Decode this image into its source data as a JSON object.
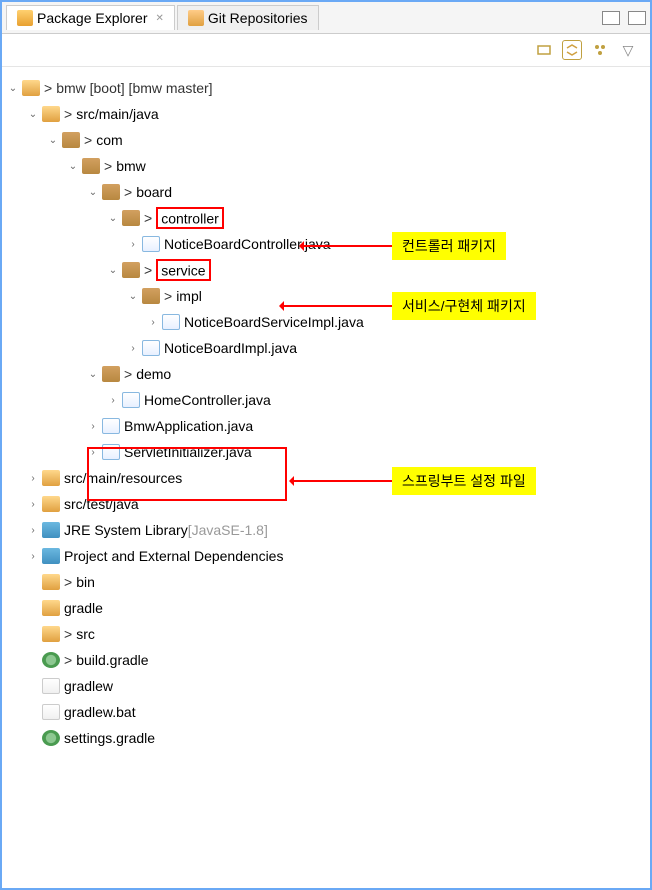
{
  "tabs": {
    "active": "Package Explorer",
    "inactive": "Git Repositories"
  },
  "tree": {
    "root": "bmw [boot] [bmw master]",
    "srcMainJava": "src/main/java",
    "com": "com",
    "bmw": "bmw",
    "board": "board",
    "controller": "controller",
    "noticeBoardController": "NoticeBoardController.java",
    "service": "service",
    "impl": "impl",
    "noticeBoardServiceImpl": "NoticeBoardServiceImpl.java",
    "noticeBoardImpl": "NoticeBoardImpl.java",
    "demo": "demo",
    "homeController": "HomeController.java",
    "bmwApplication": "BmwApplication.java",
    "servletInitializer": "ServletInitializer.java",
    "srcMainResources": "src/main/resources",
    "srcTestJava": "src/test/java",
    "jreLibrary": "JRE System Library",
    "jreSuffix": " [JavaSE-1.8]",
    "projectDeps": "Project and External Dependencies",
    "bin": "bin",
    "gradle": "gradle",
    "src": "src",
    "buildGradle": "build.gradle",
    "gradlew": "gradlew",
    "gradlewBat": "gradlew.bat",
    "settingsGradle": "settings.gradle"
  },
  "annotations": {
    "controller": "컨트롤러 패키지",
    "service": "서비스/구현체 패키지",
    "spring": "스프링부트 설정 파일"
  }
}
